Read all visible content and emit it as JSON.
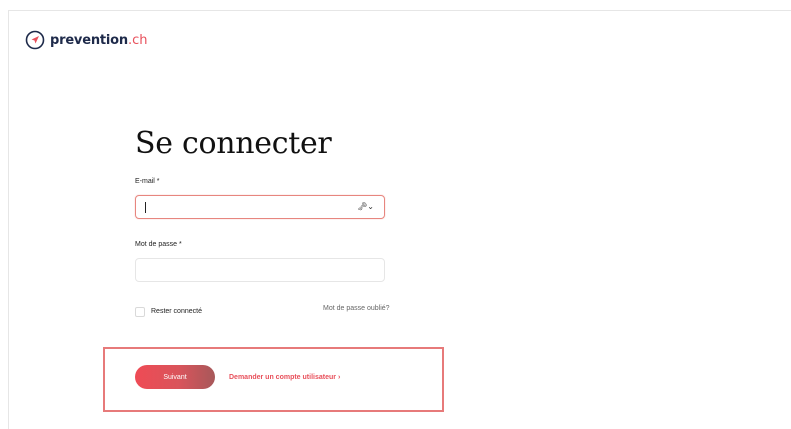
{
  "brand": {
    "name": "prevention",
    "tld": ".ch",
    "accent_color": "#e8505b",
    "dark_color": "#1e2a4a"
  },
  "login": {
    "title": "Se connecter",
    "email_label": "E-mail *",
    "email_value": "",
    "password_label": "Mot de passe *",
    "password_value": "",
    "password_manager_icon": "key-dropdown-icon",
    "remember_label": "Rester connecté",
    "remember_checked": false,
    "forgot_link": "Mot de passe oublié?",
    "submit_label": "Suivant",
    "request_account_link": "Demander un compte utilisateur",
    "request_account_chevron": "›"
  }
}
